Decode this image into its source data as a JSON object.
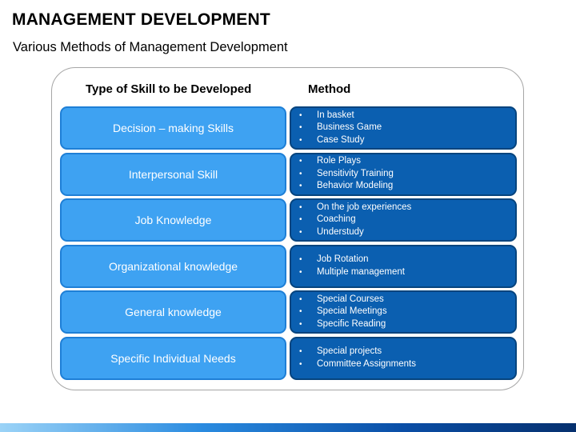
{
  "title": "MANAGEMENT DEVELOPMENT",
  "subtitle": "Various Methods of Management Development",
  "columns": {
    "skill": "Type of Skill to be Developed",
    "method": "Method"
  },
  "rows": [
    {
      "skill": "Decision – making Skills",
      "methods": [
        "In basket",
        "Business Game",
        "Case Study"
      ]
    },
    {
      "skill": "Interpersonal Skill",
      "methods": [
        "Role Plays",
        "Sensitivity Training",
        "Behavior Modeling"
      ]
    },
    {
      "skill": "Job Knowledge",
      "methods": [
        "On the job experiences",
        "Coaching",
        "Understudy"
      ]
    },
    {
      "skill": "Organizational knowledge",
      "methods": [
        "Job Rotation",
        "Multiple management"
      ]
    },
    {
      "skill": "General knowledge",
      "methods": [
        "Special Courses",
        "Special Meetings",
        "Specific Reading"
      ]
    },
    {
      "skill": "Specific Individual Needs",
      "methods": [
        "Special projects",
        "Committee Assignments"
      ]
    }
  ],
  "colors": {
    "skill_fill": "#3ea2f2",
    "method_fill": "#0b5fb0"
  }
}
